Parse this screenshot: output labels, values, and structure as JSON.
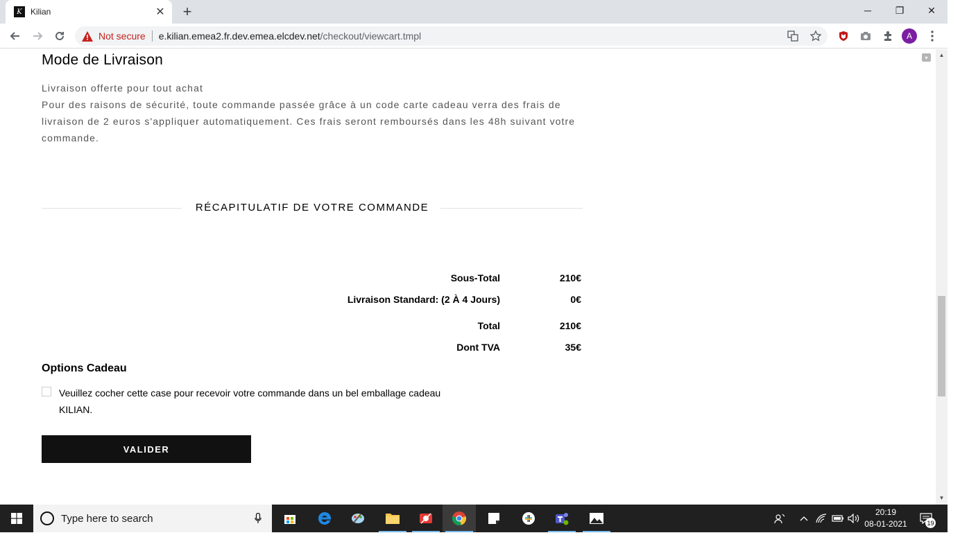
{
  "browser": {
    "tab_title": "Kilian",
    "tab_close": "✕",
    "new_tab": "+",
    "favicon_letter": "K",
    "window_controls": {
      "minimize": "─",
      "restore": "❐",
      "close": "✕"
    },
    "security_label": "Not secure",
    "url_host": "e.kilian.emea2.fr.dev.emea.elcdev.net",
    "url_path": "/checkout/viewcart.tmpl",
    "profile_initial": "A"
  },
  "page": {
    "delivery_heading": "Mode de Livraison",
    "delivery_free": "Livraison offerte pour tout achat",
    "delivery_note": "Pour des raisons de sécurité, toute commande passée grâce à un code carte cadeau verra des frais de livraison de 2 euros s'appliquer automatiquement. Ces frais seront remboursés dans les 48h suivant votre commande.",
    "summary_title": "RÉCAPITULATIF DE VOTRE COMMANDE",
    "summary": {
      "subtotal_label": "Sous-Total",
      "subtotal_value": "210€",
      "shipping_label": "Livraison Standard: (2 À 4 Jours)",
      "shipping_value": "0€",
      "total_label": "Total",
      "total_value": "210€",
      "vat_label": "Dont TVA",
      "vat_value": "35€"
    },
    "gift_heading": "Options Cadeau",
    "gift_checkbox_label": "Veuillez cocher cette case pour recevoir votre commande dans un bel emballage cadeau KILIAN.",
    "submit_label": "VALIDER"
  },
  "taskbar": {
    "search_placeholder": "Type here to search",
    "time": "20:19",
    "date": "08-01-2021",
    "notification_count": "19"
  }
}
